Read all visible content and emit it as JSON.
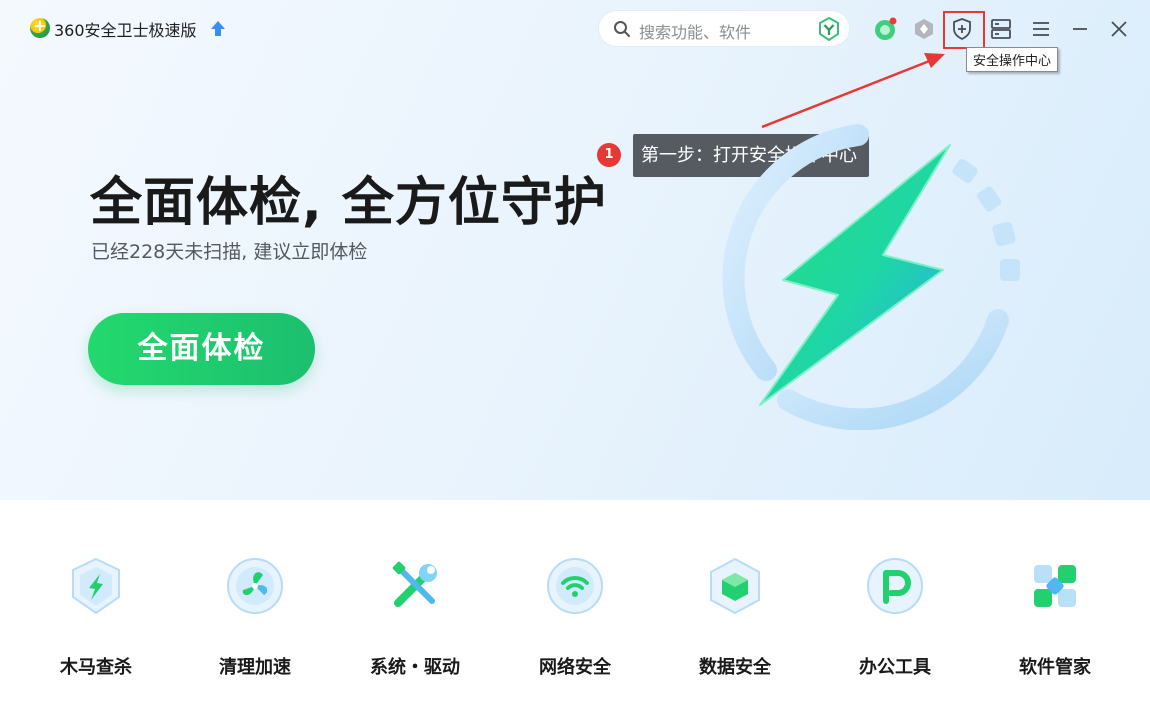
{
  "app": {
    "title": "360安全卫士极速版"
  },
  "search": {
    "placeholder": "搜索功能、软件"
  },
  "toolbar": {
    "tooltip": "安全操作中心"
  },
  "guide": {
    "step_number": "1",
    "step_text": "第一步：打开安全操作中心"
  },
  "hero": {
    "headline": "全面体检, 全方位守护",
    "subline": "已经228天未扫描, 建议立即体检",
    "scan_button": "全面体检"
  },
  "features": [
    {
      "label": "木马查杀",
      "icon": "trojan-shield-icon"
    },
    {
      "label": "清理加速",
      "icon": "cleanup-fan-icon"
    },
    {
      "label": "系统・驱动",
      "icon": "system-tools-icon"
    },
    {
      "label": "网络安全",
      "icon": "wifi-icon"
    },
    {
      "label": "数据安全",
      "icon": "data-cube-icon"
    },
    {
      "label": "办公工具",
      "icon": "office-p-icon"
    },
    {
      "label": "软件管家",
      "icon": "software-grid-icon"
    }
  ],
  "colors": {
    "accent_green": "#1fd06e",
    "highlight_red": "#e53935",
    "hero_bg": "#eaf4fd"
  }
}
